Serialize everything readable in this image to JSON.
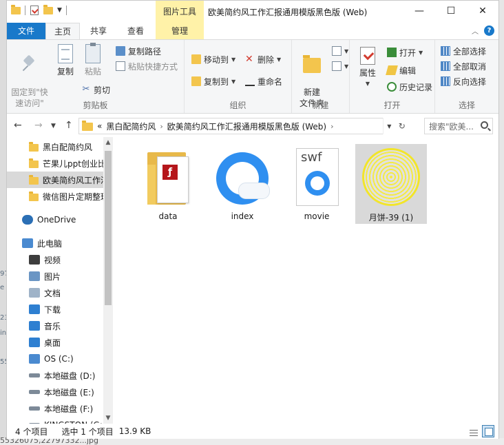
{
  "window": {
    "title": "欧美简约风工作汇报通用模版黑色版 (Web)",
    "context_tab_header": "图片工具",
    "controls": {
      "minimize": "—",
      "maximize": "☐",
      "close": "✕"
    }
  },
  "tabs": [
    {
      "label": "文件"
    },
    {
      "label": "主页"
    },
    {
      "label": "共享"
    },
    {
      "label": "查看"
    },
    {
      "label": "管理"
    }
  ],
  "ribbon": {
    "clipboard": {
      "label": "剪贴板",
      "pin_quick_access": "固定到\"快\n速访问\"",
      "copy": "复制",
      "paste": "粘贴",
      "copy_path": "复制路径",
      "paste_shortcut": "粘贴快捷方式",
      "cut": "剪切"
    },
    "organize": {
      "label": "组织",
      "move_to": "移动到",
      "copy_to": "复制到",
      "delete": "删除",
      "rename": "重命名"
    },
    "new": {
      "label": "新建",
      "new_folder": "新建\n文件夹"
    },
    "open": {
      "label": "打开",
      "properties": "属性",
      "open": "打开",
      "edit": "编辑",
      "history": "历史记录"
    },
    "select": {
      "label": "选择",
      "select_all": "全部选择",
      "select_none": "全部取消",
      "invert_selection": "反向选择"
    }
  },
  "address": {
    "overflow": "«",
    "crumbs": [
      "黑白配简约风",
      "欧美简约风工作汇报通用模版黑色版 (Web)"
    ],
    "search_placeholder": "搜索\"欧美..."
  },
  "nav": {
    "items": [
      {
        "label": "黑白配简约风",
        "icon": "folder-icon",
        "indent": 1
      },
      {
        "label": "芒果儿ppt创业比",
        "icon": "folder-icon",
        "indent": 1
      },
      {
        "label": "欧美简约风工作汇",
        "icon": "folder-icon",
        "indent": 1,
        "selected": true
      },
      {
        "label": "微信图片定期整理",
        "icon": "folder-icon",
        "indent": 1
      },
      {
        "label": "OneDrive",
        "icon": "cloud-icon",
        "indent": 0
      },
      {
        "label": "此电脑",
        "icon": "computer-icon",
        "indent": 0
      },
      {
        "label": "视频",
        "icon": "video-icon",
        "indent": 1
      },
      {
        "label": "图片",
        "icon": "pictures-icon",
        "indent": 1
      },
      {
        "label": "文档",
        "icon": "documents-icon",
        "indent": 1
      },
      {
        "label": "下载",
        "icon": "downloads-icon",
        "indent": 1
      },
      {
        "label": "音乐",
        "icon": "music-icon",
        "indent": 1
      },
      {
        "label": "桌面",
        "icon": "desktop-icon",
        "indent": 1
      },
      {
        "label": "OS (C:)",
        "icon": "os-drive-icon",
        "indent": 1
      },
      {
        "label": "本地磁盘 (D:)",
        "icon": "drive-icon",
        "indent": 1
      },
      {
        "label": "本地磁盘 (E:)",
        "icon": "drive-icon",
        "indent": 1
      },
      {
        "label": "本地磁盘 (F:)",
        "icon": "drive-icon",
        "indent": 1
      },
      {
        "label": "KINGSTON (G:",
        "icon": "usb-drive-icon",
        "indent": 1
      }
    ]
  },
  "files": [
    {
      "label": "data",
      "icon": "flash-folder-icon"
    },
    {
      "label": "index",
      "icon": "qq-browser-icon"
    },
    {
      "label": "movie",
      "icon": "swf-file-icon",
      "type_label": "swf"
    },
    {
      "label": "月饼-39 (1)",
      "icon": "mooncake-image-thumbnail",
      "selected": true
    }
  ],
  "status": {
    "item_count": "4 个项目",
    "selected": "选中 1 个项目",
    "size": "13.9 KB"
  },
  "desktop_bottom_text": "55326075,22797332...jpg",
  "colors": {
    "accent": "#1979ca",
    "context_tab": "#fff2a8",
    "selection": "#d9d9d9",
    "folder": "#f3c54d"
  }
}
